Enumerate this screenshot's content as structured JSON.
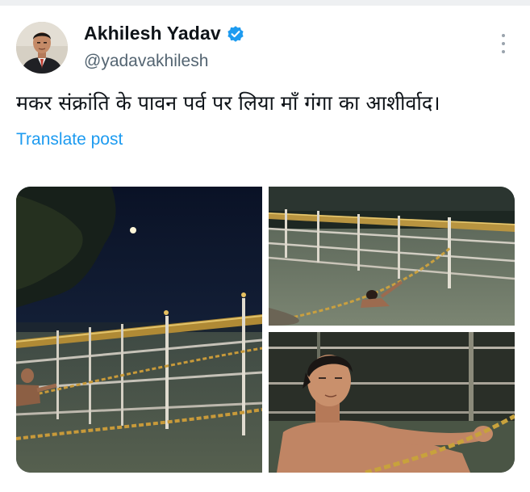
{
  "post": {
    "author": {
      "display_name": "Akhilesh Yadav",
      "handle": "@yadavakhilesh",
      "verified": true,
      "avatar_icon": "profile-avatar"
    },
    "text": "मकर संक्रांति के पावन पर्व पर लिया माँ गंगा का आशीर्वाद।",
    "translate_label": "Translate post",
    "more_icon": "more-vertical-icon",
    "media": [
      {
        "kind": "photo",
        "description_icon": "night-river-railing-photo"
      },
      {
        "kind": "photo",
        "description_icon": "river-bathing-railing-photo"
      },
      {
        "kind": "photo",
        "description_icon": "man-in-river-chain-photo"
      }
    ]
  },
  "colors": {
    "text_primary": "#0f1419",
    "text_secondary": "#536471",
    "link_blue": "#1d9bf0",
    "verified_blue": "#1d9bf0"
  }
}
